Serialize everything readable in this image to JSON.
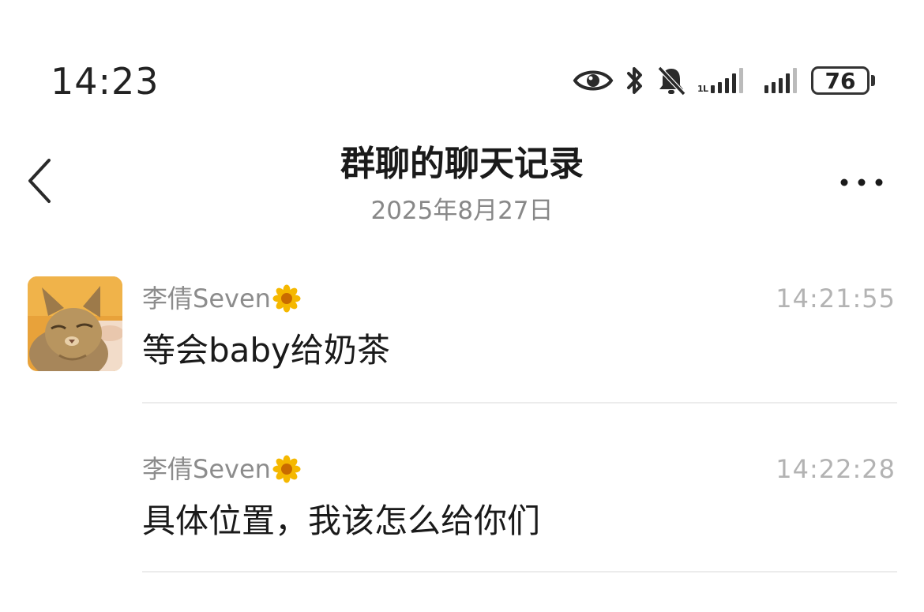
{
  "status_bar": {
    "time": "14:23",
    "battery": "76",
    "icons": [
      "eye-icon",
      "bluetooth-icon",
      "bell-off-icon",
      "signal-icon",
      "signal-icon",
      "battery-icon"
    ]
  },
  "header": {
    "title": "群聊的聊天记录",
    "date": "2025年8月27日",
    "back_icon": "chevron-left-icon",
    "more_icon": "more-dots-icon"
  },
  "messages": [
    {
      "sender": "李倩Seven",
      "sender_badge": "flower-icon",
      "time": "14:21:55",
      "text": "等会baby给奶茶",
      "avatar": "cat-avatar"
    },
    {
      "sender": "李倩Seven",
      "sender_badge": "flower-icon",
      "time": "14:22:28",
      "text": "具体位置，我该怎么给你们"
    }
  ],
  "colors": {
    "background": "#ffffff",
    "title": "#1a1a1a",
    "sender": "#8c8c8c",
    "timestamp": "#b3b3b3",
    "divider": "#ececec",
    "flower_petal": "#f5b800",
    "flower_center": "#c96b00"
  }
}
